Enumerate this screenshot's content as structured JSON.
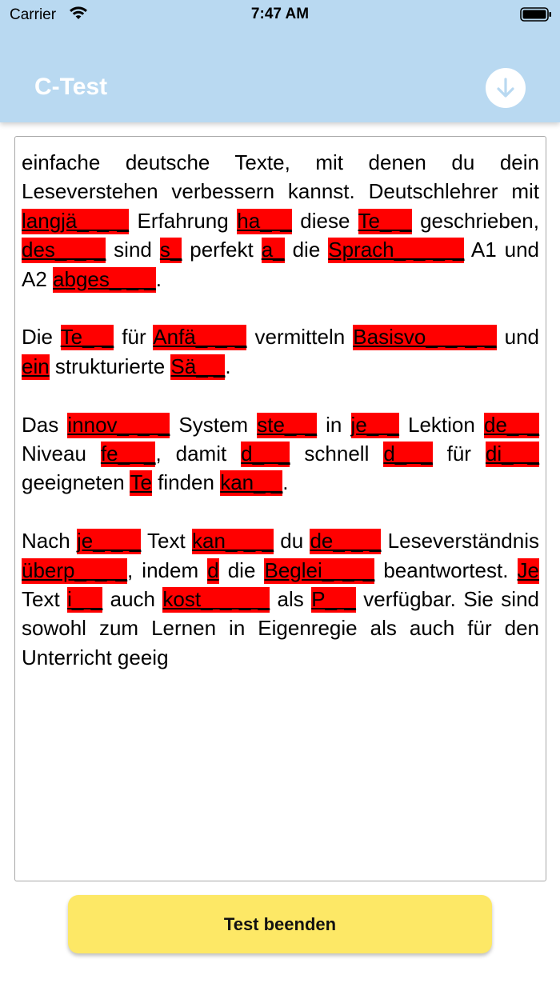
{
  "status_bar": {
    "carrier": "Carrier",
    "time": "7:47 AM"
  },
  "header": {
    "title": "C-Test"
  },
  "colors": {
    "header_bg": "#b9d9f1",
    "gap_fill": "#ff0000",
    "button_bg": "#fde866"
  },
  "paragraphs": [
    [
      {
        "t": "einfache deutsche Texte, mit denen du dein Leseverstehen verbessern kannst. Deutschlehrer mit "
      },
      {
        "g": "langjä_ _ _"
      },
      {
        "t": " Erfahrung "
      },
      {
        "g": "ha_ _"
      },
      {
        "t": " diese "
      },
      {
        "g": "Te_ _"
      },
      {
        "t": " geschrieben, "
      },
      {
        "g": "des_ _ _"
      },
      {
        "t": " sind "
      },
      {
        "g": "s_"
      },
      {
        "t": " perfekt "
      },
      {
        "g": "a_"
      },
      {
        "t": " die "
      },
      {
        "g": "Sprach_ _ _ _"
      },
      {
        "t": " A1 und A2 "
      },
      {
        "g": "abges_ _ _"
      },
      {
        "t": "."
      }
    ],
    [
      {
        "t": "Die "
      },
      {
        "g": "Te_ _"
      },
      {
        "t": " für "
      },
      {
        "g": "Anfä_ _ _"
      },
      {
        "t": " vermitteln "
      },
      {
        "g": "Basisvo_ _ _ _"
      },
      {
        "t": " und "
      },
      {
        "g": "ein"
      },
      {
        "t": " strukturierte "
      },
      {
        "g": "Sä_ _"
      },
      {
        "t": "."
      }
    ],
    [
      {
        "t": "Das "
      },
      {
        "g": "innov_ _ _"
      },
      {
        "t": " System "
      },
      {
        "g": "ste_ _"
      },
      {
        "t": " in "
      },
      {
        "g": "je_ _"
      },
      {
        "t": " Lektion "
      },
      {
        "g": "de_ _"
      },
      {
        "t": " Niveau "
      },
      {
        "g": "fe_ _"
      },
      {
        "t": ", damit "
      },
      {
        "g": "d_ _"
      },
      {
        "t": " schnell "
      },
      {
        "g": "d_ _"
      },
      {
        "t": " für "
      },
      {
        "g": "di_ _"
      },
      {
        "t": " geeigneten "
      },
      {
        "g": "Te"
      },
      {
        "t": " finden "
      },
      {
        "g": "kan_ _"
      },
      {
        "t": "."
      }
    ],
    [
      {
        "t": "Nach "
      },
      {
        "g": "je_ _ _"
      },
      {
        "t": " Text "
      },
      {
        "g": "kan_ _ _"
      },
      {
        "t": " du "
      },
      {
        "g": "de_ _ _"
      },
      {
        "t": " Leseverständnis "
      },
      {
        "g": "überp_ _ _"
      },
      {
        "t": ", indem "
      },
      {
        "g": "d"
      },
      {
        "t": " die "
      },
      {
        "g": "Beglei_ _ _"
      },
      {
        "t": " beantwortest. "
      },
      {
        "g": "Je"
      },
      {
        "t": " Text "
      },
      {
        "g": "i_ _"
      },
      {
        "t": " auch "
      },
      {
        "g": "kost_ _ _ _"
      },
      {
        "t": " als "
      },
      {
        "g": "P_ _"
      },
      {
        "t": " verfügbar. Sie sind sowohl zum Lernen in Eigenregie als auch für den Unterricht geeig"
      }
    ]
  ],
  "end_button": {
    "label": "Test beenden"
  }
}
